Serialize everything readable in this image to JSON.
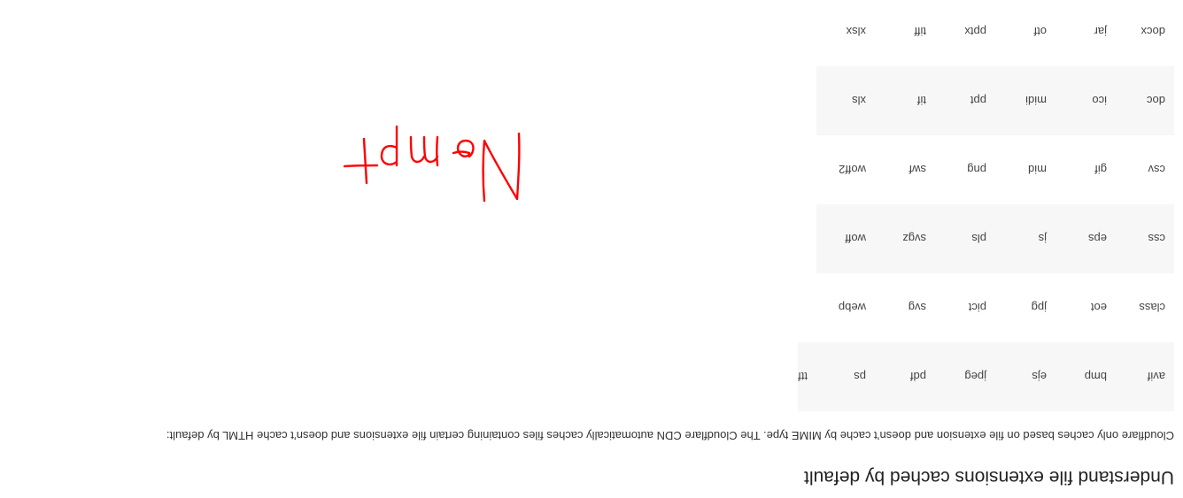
{
  "section": {
    "heading": "Understand file extensions cached by default",
    "description": "Cloudflare only caches based on file extension and doesn’t cache by MIME type. The Cloudflare CDN automatically caches files containing certain file extensions and doesn’t cache HTML by default:"
  },
  "extensions": {
    "rows": [
      [
        "avif",
        "bmp",
        "ejs",
        "jpeg",
        "pdf",
        "ps",
        "ttf"
      ],
      [
        "class",
        "eot",
        "jpg",
        "pict",
        "svg",
        "webp",
        ""
      ],
      [
        "css",
        "eps",
        "js",
        "pls",
        "svgz",
        "woff",
        ""
      ],
      [
        "csv",
        "gif",
        "mid",
        "png",
        "swf",
        "woff2",
        ""
      ],
      [
        "doc",
        "ico",
        "midi",
        "ppt",
        "tif",
        "xls",
        ""
      ],
      [
        "docx",
        "jar",
        "otf",
        "pptx",
        "tiff",
        "xlsx",
        ""
      ]
    ]
  },
  "annotation": {
    "text": "No mpt",
    "color": "#ff0000"
  }
}
